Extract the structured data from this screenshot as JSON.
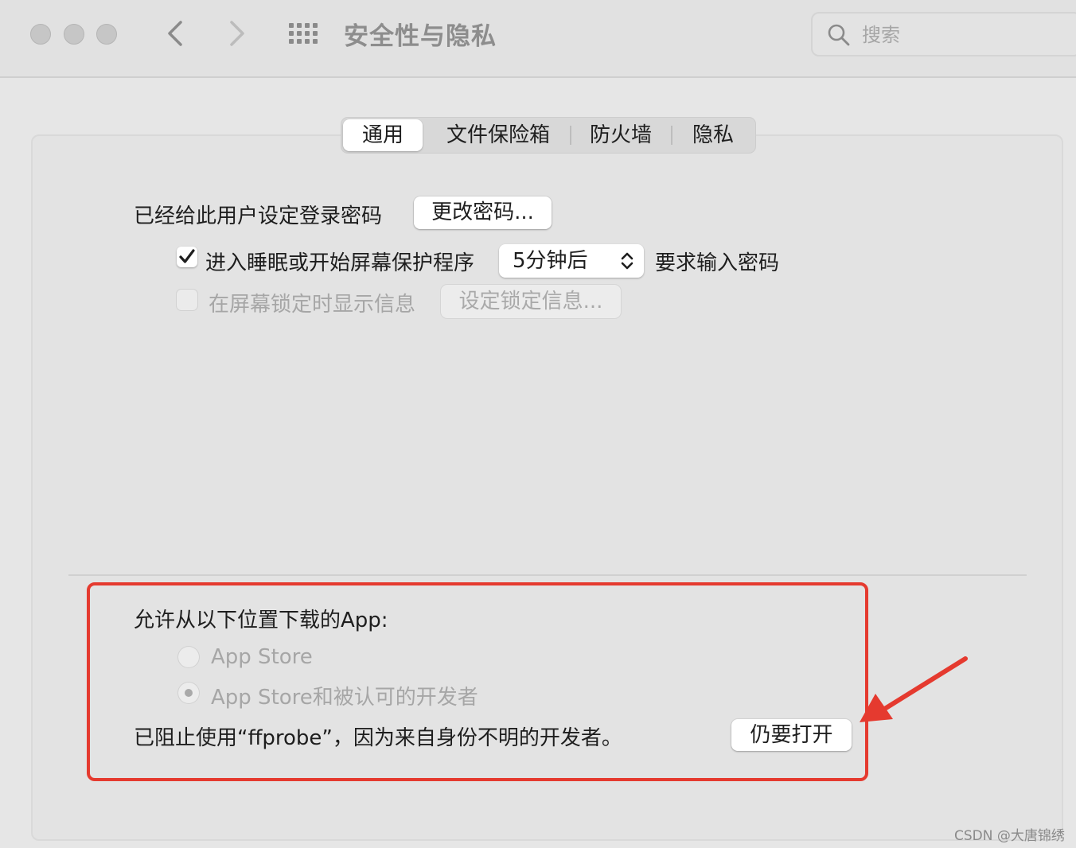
{
  "window": {
    "title": "安全性与隐私",
    "search_placeholder": "搜索"
  },
  "tabs": [
    {
      "label": "通用",
      "active": true
    },
    {
      "label": "文件保险箱",
      "active": false
    },
    {
      "label": "防火墙",
      "active": false
    },
    {
      "label": "隐私",
      "active": false
    }
  ],
  "general": {
    "password_set_label": "已经给此用户设定登录密码",
    "change_password_button": "更改密码...",
    "require_password": {
      "checked": true,
      "label": "进入睡眠或开始屏幕保护程序",
      "delay_value": "5分钟后",
      "suffix": "要求输入密码"
    },
    "lock_message": {
      "checked": false,
      "enabled": false,
      "label": "在屏幕锁定时显示信息",
      "button": "设定锁定信息..."
    }
  },
  "downloads": {
    "heading": "允许从以下位置下载的App:",
    "options": [
      {
        "label": "App Store",
        "selected": false
      },
      {
        "label": "App Store和被认可的开发者",
        "selected": true
      }
    ],
    "blocked_message": "已阻止使用“ffprobe”，因为来自身份不明的开发者。",
    "open_anyway_button": "仍要打开"
  },
  "watermark": "CSDN @大唐锦绣",
  "colors": {
    "annotation": "#e53a2f",
    "panel": "#e3e3e3"
  }
}
